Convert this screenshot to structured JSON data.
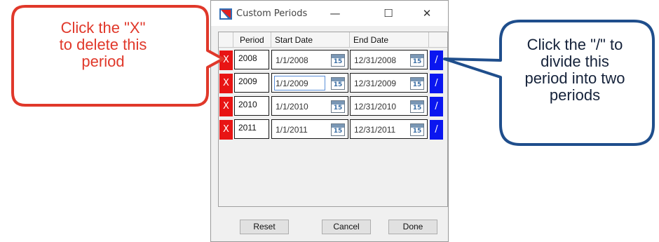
{
  "window": {
    "title": "Custom Periods",
    "minimize": "—",
    "maximize": "☐",
    "close": "✕"
  },
  "grid": {
    "headers": {
      "period": "Period",
      "start": "Start Date",
      "end": "End Date"
    },
    "delete_label": "X",
    "divide_label": "/",
    "calendar_icon_text": "15",
    "rows": [
      {
        "period": "2008",
        "start": "1/1/2008",
        "end": "12/31/2008"
      },
      {
        "period": "2009",
        "start": "1/1/2009",
        "end": "12/31/2009"
      },
      {
        "period": "2010",
        "start": "1/1/2010",
        "end": "12/31/2010"
      },
      {
        "period": "2011",
        "start": "1/1/2011",
        "end": "12/31/2011"
      }
    ]
  },
  "footer": {
    "reset": "Reset",
    "cancel": "Cancel",
    "done": "Done"
  },
  "callouts": {
    "delete_line1": "Click the \"X\"",
    "delete_line2": "to delete this",
    "delete_line3": "period",
    "divide_line1": "Click the \"/\" to",
    "divide_line2": "divide this",
    "divide_line3": "period into two",
    "divide_line4": "periods"
  },
  "colors": {
    "delete_red": "#e81414",
    "divide_blue": "#0a16f0",
    "callout_red": "#e0382a",
    "callout_blue": "#1f4e8c"
  }
}
